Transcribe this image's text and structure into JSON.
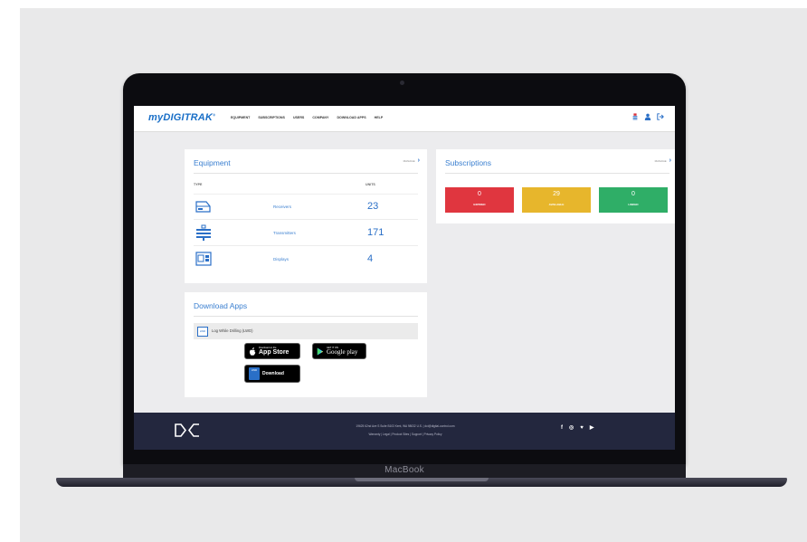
{
  "device": {
    "brand_label": "MacBook"
  },
  "nav": {
    "logo_prefix": "my",
    "logo_main": "DIGITRAK",
    "logo_mark": "®",
    "menu": [
      "EQUIPMENT",
      "SUBSCRIPTIONS",
      "USERS",
      "COMPANY",
      "DOWNLOAD APPS",
      "HELP"
    ]
  },
  "equipment": {
    "title": "Equipment",
    "link_label": "MANAGE",
    "header_type": "TYPE",
    "header_units": "UNITS",
    "rows": [
      {
        "label": "Receivers",
        "count": "23",
        "icon": "receiver-icon"
      },
      {
        "label": "Transmitters",
        "count": "171",
        "icon": "transmitter-icon"
      },
      {
        "label": "Displays",
        "count": "4",
        "icon": "display-icon"
      }
    ]
  },
  "subscriptions": {
    "title": "Subscriptions",
    "link_label": "MANAGE",
    "boxes": [
      {
        "value": "0",
        "label": "EXPIRED",
        "color": "#e0363f"
      },
      {
        "value": "29",
        "label": "AVAILABLE",
        "color": "#e7b62c"
      },
      {
        "value": "0",
        "label": "LINKED",
        "color": "#2fae67"
      }
    ]
  },
  "downloads": {
    "title": "Download Apps",
    "app_badge": "LWD",
    "app_name": "Log While Drilling (LWD)",
    "app_store_small": "Download on the",
    "app_store_big": "App Store",
    "google_small": "GET IT ON",
    "google_big": "Google play",
    "lwd_badge": "LWD",
    "lwd_download": "Download"
  },
  "footer": {
    "address": "19625 62nd Ave S Suite B103 Kent, WA 98032 U.S. | dci@digital-control.com",
    "links": "Warranty | Legal | Product Sites | Support | Privacy Policy",
    "social": [
      "f",
      "◎",
      "♥",
      "▶"
    ]
  },
  "colors": {
    "brand_blue": "#2a6fc7",
    "footer_navy": "#23273e",
    "expired": "#e0363f",
    "available": "#e7b62c",
    "linked": "#2fae67"
  }
}
